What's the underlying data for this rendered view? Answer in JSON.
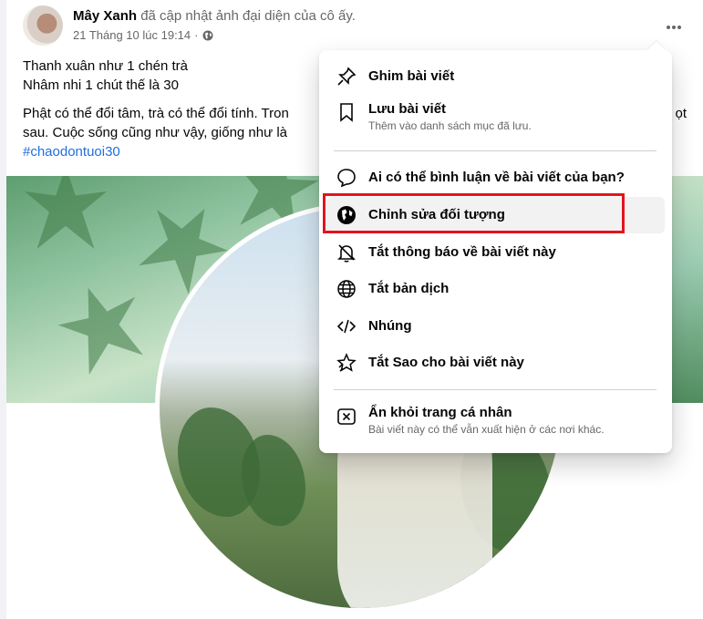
{
  "post": {
    "author": "Mây Xanh",
    "action": "đã cập nhật ảnh đại diện của cô ấy.",
    "timestamp": "21 Tháng 10 lúc 19:14",
    "separator": "·",
    "privacy_icon": "globe-icon",
    "more_icon": "more-options-icon",
    "caption_lines": [
      "Thanh xuân như 1 chén trà",
      "Nhâm nhi 1 chút thế là 30"
    ],
    "caption_paragraph": "Phật có thể đổi tâm, trà có thể đổi tính. Tron",
    "caption_paragraph_end": "ọt",
    "caption_paragraph_line2": "sau. Cuộc sống cũng như vậy, giống như là",
    "hashtag": "#chaodontuoi30"
  },
  "menu": {
    "items": [
      {
        "label": "Ghim bài viết",
        "icon": "pin-icon"
      },
      {
        "label": "Lưu bài viết",
        "sublabel": "Thêm vào danh sách mục đã lưu.",
        "icon": "bookmark-icon"
      },
      {
        "label": "Ai có thể bình luận về bài viết của bạn?",
        "icon": "comment-icon"
      },
      {
        "label": "Chỉnh sửa đối tượng",
        "icon": "audience-globe-icon"
      },
      {
        "label": "Tắt thông báo về bài viết này",
        "icon": "bell-off-icon"
      },
      {
        "label": "Tắt bản dịch",
        "icon": "translate-globe-icon"
      },
      {
        "label": "Nhúng",
        "icon": "code-icon"
      },
      {
        "label": "Tắt Sao cho bài viết này",
        "icon": "star-icon"
      },
      {
        "label": "Ẩn khỏi trang cá nhân",
        "sublabel": "Bài viết này có thể vẫn xuất hiện ở các nơi khác.",
        "icon": "close-box-icon"
      }
    ]
  },
  "colors": {
    "accent_blue": "#216fdb",
    "highlight_red": "#e3141d",
    "text_primary": "#050505",
    "text_secondary": "#65676b"
  }
}
